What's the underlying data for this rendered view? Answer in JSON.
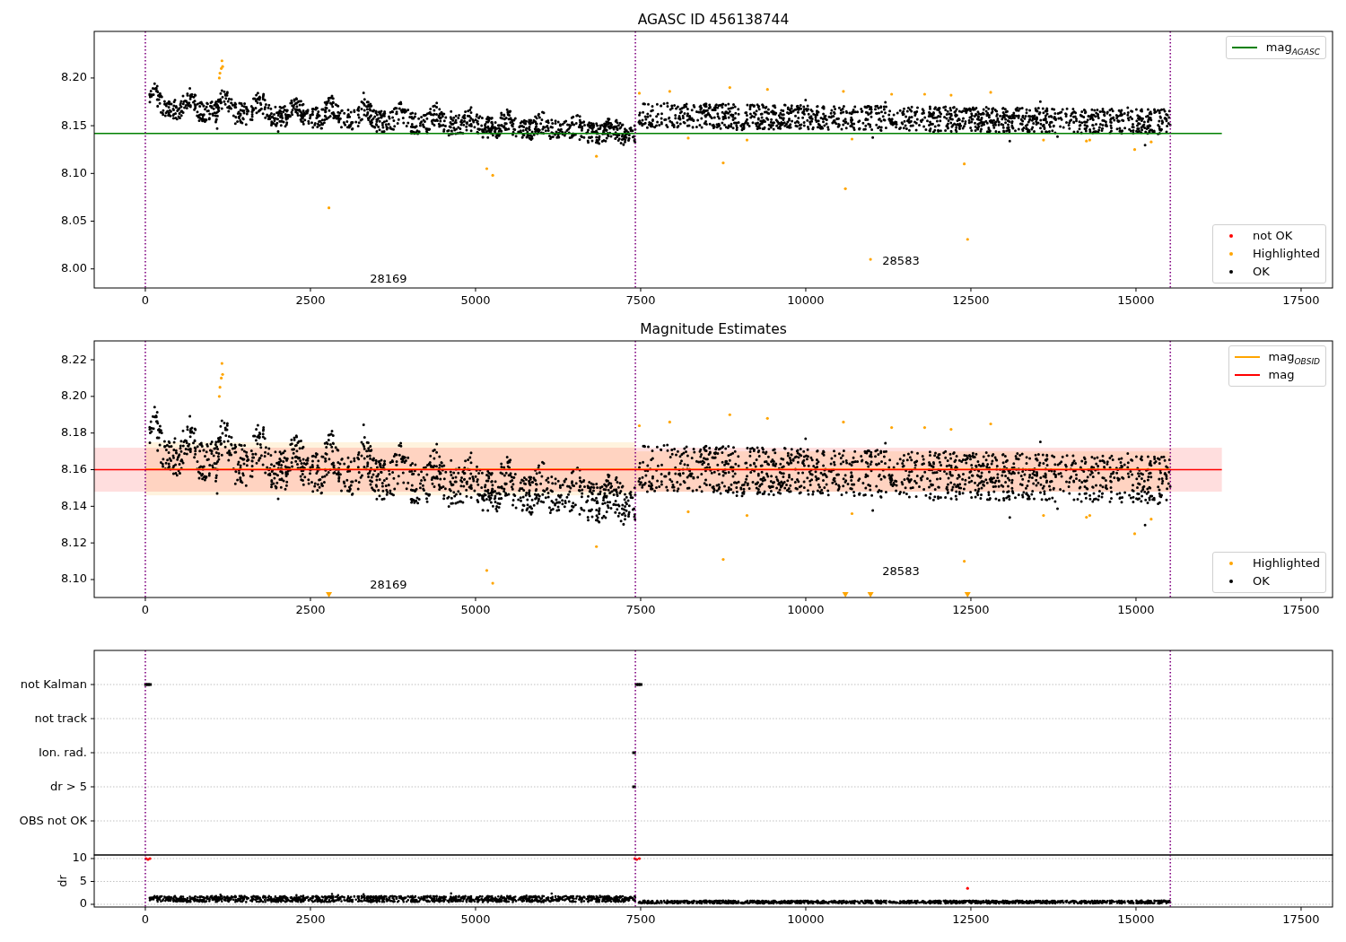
{
  "panels": [
    {
      "kind": "magnitude",
      "title": "AGASC ID 456138744",
      "y_ticks": [
        "8.20",
        "8.15",
        "8.10",
        "8.05",
        "8.00"
      ],
      "x_ticks": [
        "0",
        "2500",
        "5000",
        "7500",
        "10000",
        "12500",
        "15000",
        "17500"
      ],
      "annotations": [
        "28169",
        "28583"
      ],
      "legends": [
        [
          {
            "kind": "line",
            "label": "mag$_{AGASC}$",
            "color": "#008000"
          }
        ],
        [
          {
            "kind": "marker",
            "label": "not OK",
            "color": "#ff0000"
          },
          {
            "kind": "marker",
            "label": "Highlighted",
            "color": "#ffa500"
          },
          {
            "kind": "marker",
            "label": "OK",
            "color": "#000000"
          }
        ]
      ]
    },
    {
      "kind": "magnitude",
      "title": "Magnitude Estimates",
      "y_ticks": [
        "8.22",
        "8.20",
        "8.18",
        "8.16",
        "8.14",
        "8.12",
        "8.10"
      ],
      "x_ticks": [
        "0",
        "2500",
        "5000",
        "7500",
        "10000",
        "12500",
        "15000",
        "17500"
      ],
      "annotations": [
        "28169",
        "28583"
      ],
      "legends": [
        [
          {
            "kind": "line",
            "label": "mag$_{OBSID}$",
            "color": "#ffa500"
          },
          {
            "kind": "line",
            "label": "mag",
            "color": "#ff0000"
          }
        ],
        [
          {
            "kind": "marker",
            "label": "Highlighted",
            "color": "#ffa500"
          },
          {
            "kind": "marker",
            "label": "OK",
            "color": "#000000"
          }
        ]
      ]
    },
    {
      "kind": "flags",
      "y_categories": [
        "not Kalman",
        "not track",
        "Ion. rad.",
        "dr > 5",
        "OBS not OK"
      ]
    },
    {
      "kind": "dr",
      "ylabel": "dr",
      "y_ticks": [
        "10",
        "5",
        "0"
      ],
      "x_ticks": [
        "0",
        "2500",
        "5000",
        "7500",
        "10000",
        "12500",
        "15000",
        "17500"
      ]
    }
  ]
}
